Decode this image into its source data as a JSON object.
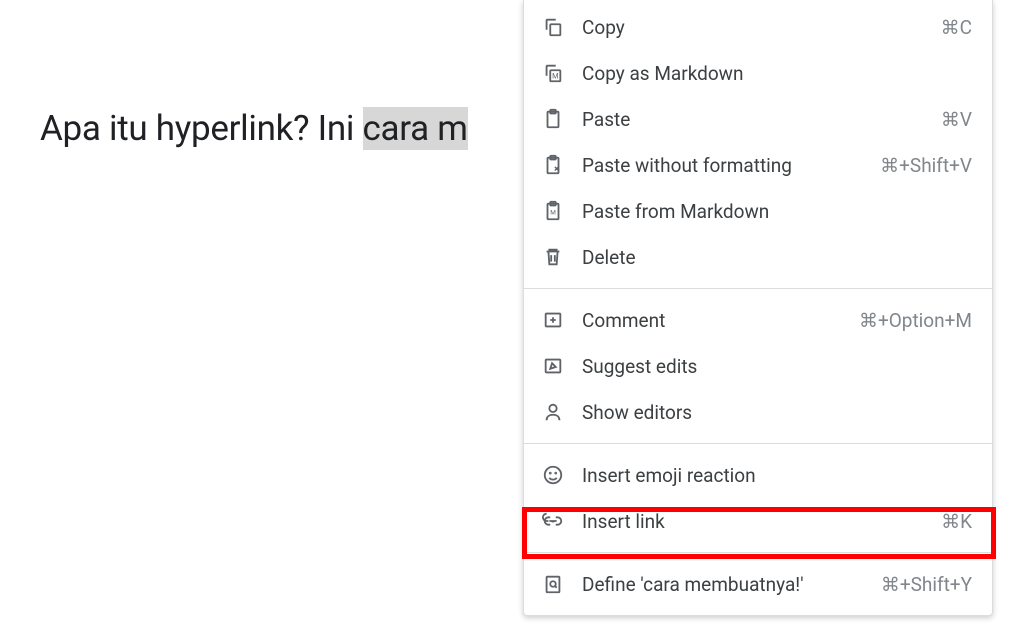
{
  "document": {
    "text_before": "Apa itu hyperlink? Ini ",
    "selected": "cara m",
    "text_cut": ""
  },
  "menu": {
    "items": [
      {
        "icon": "copy",
        "label": "Copy",
        "shortcut": "⌘C"
      },
      {
        "icon": "markdown-copy",
        "label": "Copy as Markdown",
        "shortcut": ""
      },
      {
        "icon": "paste",
        "label": "Paste",
        "shortcut": "⌘V"
      },
      {
        "icon": "paste-nofmt",
        "label": "Paste without formatting",
        "shortcut": "⌘+Shift+V"
      },
      {
        "icon": "paste-md",
        "label": "Paste from Markdown",
        "shortcut": ""
      },
      {
        "icon": "delete",
        "label": "Delete",
        "shortcut": ""
      }
    ],
    "items2": [
      {
        "icon": "comment",
        "label": "Comment",
        "shortcut": "⌘+Option+M"
      },
      {
        "icon": "suggest",
        "label": "Suggest edits",
        "shortcut": ""
      },
      {
        "icon": "editors",
        "label": "Show editors",
        "shortcut": ""
      }
    ],
    "items3": [
      {
        "icon": "emoji",
        "label": "Insert emoji reaction",
        "shortcut": ""
      },
      {
        "icon": "link",
        "label": "Insert link",
        "shortcut": "⌘K"
      }
    ],
    "items4": [
      {
        "icon": "define",
        "label": "Define 'cara membuatnya!'",
        "shortcut": "⌘+Shift+Y"
      }
    ]
  }
}
